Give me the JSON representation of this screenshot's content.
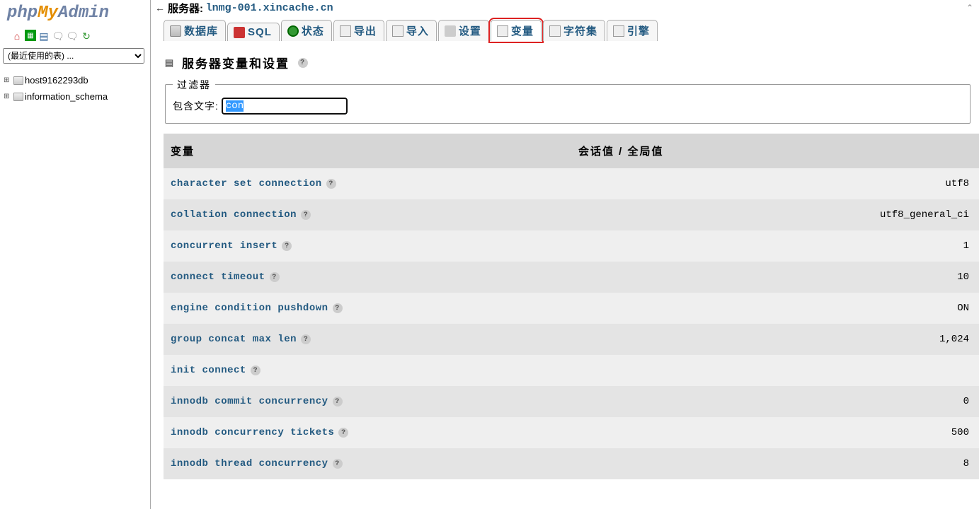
{
  "logo": {
    "php": "php",
    "my": "My",
    "admin": "Admin"
  },
  "sidebar": {
    "recent_select": "(最近使用的表) ...",
    "databases": [
      {
        "name": "host9162293db"
      },
      {
        "name": "information_schema"
      }
    ]
  },
  "server": {
    "label": "服务器:",
    "host": "lnmg-001.xincache.cn"
  },
  "tabs": [
    {
      "label": "数据库",
      "icon": "db"
    },
    {
      "label": "SQL",
      "icon": "sql"
    },
    {
      "label": "状态",
      "icon": "status"
    },
    {
      "label": "导出",
      "icon": "export"
    },
    {
      "label": "导入",
      "icon": "import"
    },
    {
      "label": "设置",
      "icon": "settings"
    },
    {
      "label": "变量",
      "icon": "vars",
      "active": true,
      "highlight": true
    },
    {
      "label": "字符集",
      "icon": "charset"
    },
    {
      "label": "引擎",
      "icon": "engine"
    }
  ],
  "page_title": "服务器变量和设置",
  "filter": {
    "legend": "过滤器",
    "label": "包含文字:",
    "value": "con"
  },
  "table": {
    "head_var": "变量",
    "head_val": "会话值 / 全局值",
    "rows": [
      {
        "name": "character set connection",
        "value": "utf8",
        "help": true
      },
      {
        "name": "collation connection",
        "value": "utf8_general_ci",
        "help": true
      },
      {
        "name": "concurrent insert",
        "value": "1",
        "help": true
      },
      {
        "name": "connect timeout",
        "value": "10",
        "help": true
      },
      {
        "name": "engine condition pushdown",
        "value": "ON",
        "help": true
      },
      {
        "name": "group concat max len",
        "value": "1,024",
        "help": true
      },
      {
        "name": "init connect",
        "value": "",
        "help": true
      },
      {
        "name": "innodb commit concurrency",
        "value": "0",
        "help": true
      },
      {
        "name": "innodb concurrency tickets",
        "value": "500",
        "help": true
      },
      {
        "name": "innodb thread concurrency",
        "value": "8",
        "help": true
      }
    ]
  }
}
